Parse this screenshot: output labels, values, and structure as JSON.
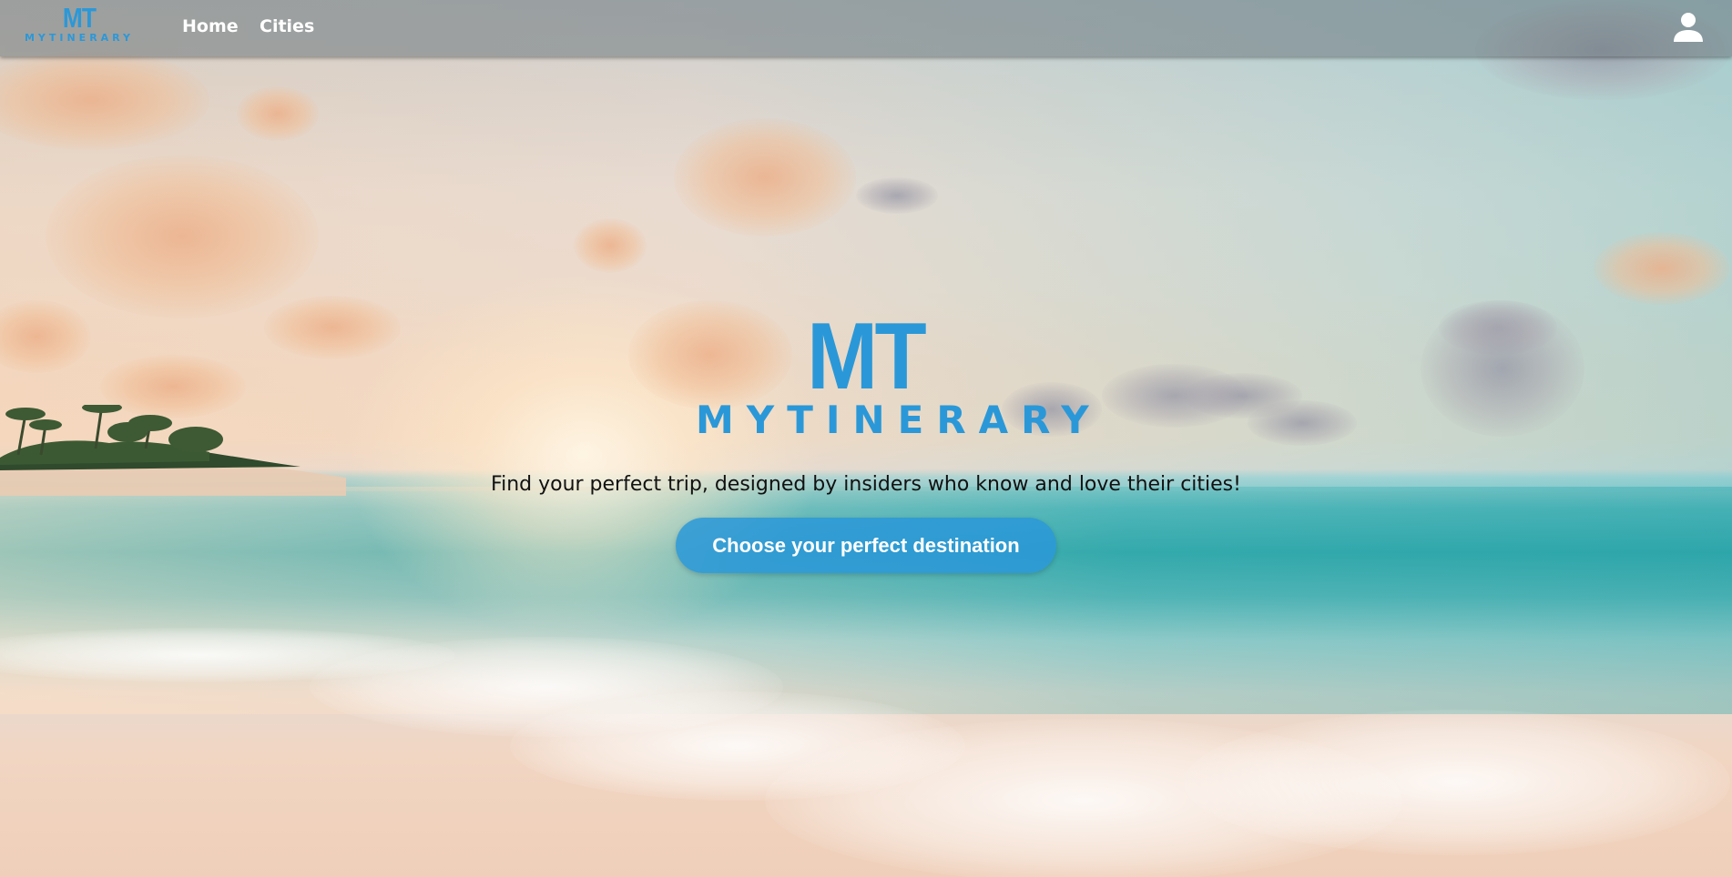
{
  "nav": {
    "logo": {
      "mark": "MT",
      "wordmark": "MYTINERARY"
    },
    "links": [
      {
        "label": "Home"
      },
      {
        "label": "Cities"
      }
    ],
    "user_icon": "user-icon"
  },
  "hero": {
    "logo": {
      "mark": "MT",
      "wordmark": "MYTINERARY"
    },
    "tagline": "Find your perfect trip, designed by insiders who know and love their cities!",
    "cta_label": "Choose your perfect destination"
  },
  "colors": {
    "brand_blue": "#2a98d8",
    "navbar_bg": "rgba(110,120,125,0.55)",
    "nav_text": "#ffffff",
    "tagline_text": "#111111"
  },
  "background": "sunset beach photo"
}
